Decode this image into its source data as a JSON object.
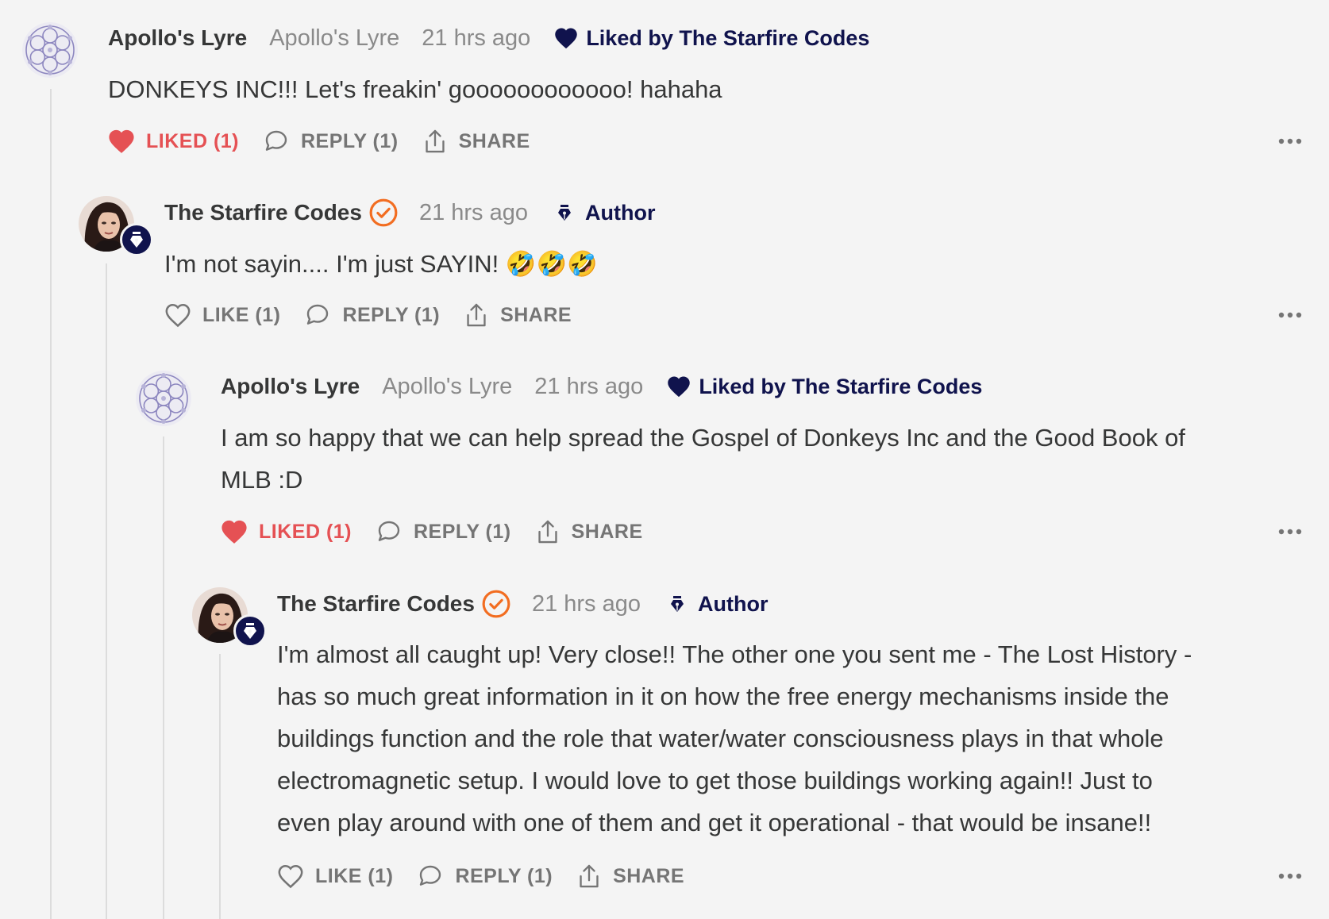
{
  "colors": {
    "background": "#f4f4f4",
    "navy": "#10134d",
    "liked_red": "#e55154",
    "muted_gray": "#8a8a8a",
    "verified_orange": "#f26d21"
  },
  "comments": [
    {
      "name": "Apollo's Lyre",
      "handle": "Apollo's Lyre",
      "time": "21 hrs ago",
      "liked_by": "Liked by The Starfire Codes",
      "body": "DONKEYS INC!!! Let's freakin' goooooooooooo! hahaha",
      "like_label": "LIKED (1)",
      "like_state": "liked",
      "reply_label": "REPLY (1)",
      "share_label": "SHARE",
      "avatar_icon": "mandala-avatar-icon"
    },
    {
      "name": "The Starfire Codes",
      "time": "21 hrs ago",
      "author_label": "Author",
      "body": "I'm not sayin.... I'm just SAYIN! 🤣🤣🤣",
      "like_label": "LIKE (1)",
      "like_state": "not-liked",
      "reply_label": "REPLY (1)",
      "share_label": "SHARE",
      "avatar_icon": "author-avatar-icon"
    },
    {
      "name": "Apollo's Lyre",
      "handle": "Apollo's Lyre",
      "time": "21 hrs ago",
      "liked_by": "Liked by The Starfire Codes",
      "body_line1": "I am so happy that we can help spread the Gospel of Donkeys Inc and the Good Book of",
      "body_line2": "MLB :D",
      "like_label": "LIKED (1)",
      "like_state": "liked",
      "reply_label": "REPLY (1)",
      "share_label": "SHARE",
      "avatar_icon": "mandala-avatar-icon"
    },
    {
      "name": "The Starfire Codes",
      "time": "21 hrs ago",
      "author_label": "Author",
      "body_lines": [
        "I'm almost all caught up! Very close!! The other one you sent me - The Lost History -",
        "has so much great information in it on how the free energy mechanisms inside the",
        "buildings function and the role that water/water consciousness plays in that whole",
        "electromagnetic setup. I would love to get those buildings working again!! Just to",
        "even play around with one of them and get it operational - that would be insane!!"
      ],
      "like_label": "LIKE (1)",
      "like_state": "not-liked",
      "reply_label": "REPLY (1)",
      "share_label": "SHARE",
      "avatar_icon": "author-avatar-icon"
    }
  ]
}
